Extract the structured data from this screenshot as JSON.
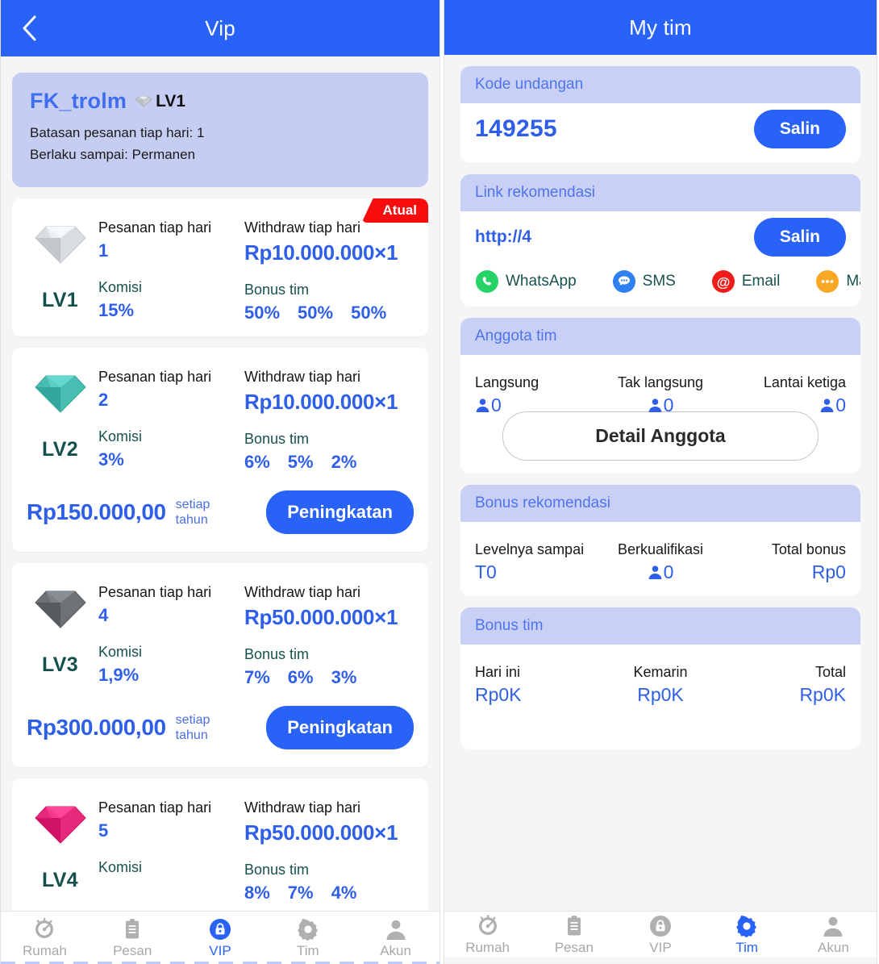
{
  "colors": {
    "accent": "#2962f6",
    "value_blue": "#2f5fe8",
    "card_head_bg": "#c8d0f5",
    "summary_bg": "#c5cdf2",
    "badge_red": "#f70d0d",
    "lv_label_teal": "#13504c",
    "page_bg": "#f5f5f6"
  },
  "left": {
    "header": {
      "title": "Vip",
      "back_icon": "chevron-left-icon"
    },
    "summary": {
      "username": "FK_trolm",
      "gem_icon": "diamond-icon",
      "level_badge": "LV1",
      "line1": "Batasan pesanan tiap hari: 1",
      "line2": "Berlaku sampai: Permanen"
    },
    "labels": {
      "orders_per_day": "Pesanan tiap hari",
      "commission": "Komisi",
      "withdraw_per_day": "Withdraw tiap hari",
      "team_bonus": "Bonus tim",
      "per_year": "setiap tahun",
      "upgrade": "Peningkatan",
      "current_badge": "Atual"
    },
    "levels": [
      {
        "name": "LV1",
        "gem_icon": "diamond-white-icon",
        "gem_color": "#d9dde1",
        "orders_per_day": "1",
        "commission": "15%",
        "withdraw_per_day": "Rp10.000.000×1",
        "team_bonus": [
          "50%",
          "50%",
          "50%"
        ],
        "is_current": true,
        "price": null,
        "show_upgrade": false
      },
      {
        "name": "LV2",
        "gem_icon": "diamond-teal-icon",
        "gem_color": "#49bdb2",
        "orders_per_day": "2",
        "commission": "3%",
        "withdraw_per_day": "Rp10.000.000×1",
        "team_bonus": [
          "6%",
          "5%",
          "2%"
        ],
        "is_current": false,
        "price": "Rp150.000,00",
        "show_upgrade": true
      },
      {
        "name": "LV3",
        "gem_icon": "diamond-dark-icon",
        "gem_color": "#6d7277",
        "orders_per_day": "4",
        "commission": "1,9%",
        "withdraw_per_day": "Rp50.000.000×1",
        "team_bonus": [
          "7%",
          "6%",
          "3%"
        ],
        "is_current": false,
        "price": "Rp300.000,00",
        "show_upgrade": true
      },
      {
        "name": "LV4",
        "gem_icon": "diamond-pink-icon",
        "gem_color": "#e6297a",
        "orders_per_day": "5",
        "commission": "",
        "withdraw_per_day": "Rp50.000.000×1",
        "team_bonus": [
          "8%",
          "7%",
          "4%"
        ],
        "is_current": false,
        "price": null,
        "show_upgrade": false
      }
    ],
    "tabs": [
      {
        "label": "Rumah",
        "icon": "speedometer-icon",
        "active": false
      },
      {
        "label": "Pesan",
        "icon": "clipboard-icon",
        "active": false
      },
      {
        "label": "VIP",
        "icon": "lock-bag-icon",
        "active": true
      },
      {
        "label": "Tim",
        "icon": "gear-icon",
        "active": false
      },
      {
        "label": "Akun",
        "icon": "person-icon",
        "active": false
      }
    ]
  },
  "right": {
    "header": {
      "title": "My tim"
    },
    "invite_code": {
      "heading": "Kode undangan",
      "value": "149255",
      "copy_label": "Salin"
    },
    "referral_link": {
      "heading": "Link rekomendasi",
      "value": "http://4",
      "copy_label": "Salin",
      "share": [
        {
          "label": "WhatsApp",
          "icon": "whatsapp-icon",
          "color": "#25d366"
        },
        {
          "label": "SMS",
          "icon": "sms-icon",
          "color": "#2f80f0"
        },
        {
          "label": "Email",
          "icon": "email-at-icon",
          "color": "#f01c1c"
        },
        {
          "label": "Mais",
          "icon": "more-dots-icon",
          "color": "#f9a825"
        }
      ]
    },
    "team_members": {
      "heading": "Anggota tim",
      "stats": [
        {
          "label": "Langsung",
          "value": "0",
          "icon": "person-icon"
        },
        {
          "label": "Tak langsung",
          "value": "0",
          "icon": "person-icon"
        },
        {
          "label": "Lantai ketiga",
          "value": "0",
          "icon": "person-icon"
        }
      ],
      "detail_button": "Detail Anggota"
    },
    "referral_bonus": {
      "heading": "Bonus rekomendasi",
      "stats": [
        {
          "label": "Levelnya sampai",
          "value": "T0",
          "icon": null
        },
        {
          "label": "Berkualifikasi",
          "value": "0",
          "icon": "person-icon"
        },
        {
          "label": "Total bonus",
          "value": "Rp0",
          "icon": null
        }
      ]
    },
    "team_bonus": {
      "heading": "Bonus tim",
      "stats": [
        {
          "label": "Hari ini",
          "value": "Rp0K",
          "icon": null
        },
        {
          "label": "Kemarin",
          "value": "Rp0K",
          "icon": null
        },
        {
          "label": "Total",
          "value": "Rp0K",
          "icon": null
        }
      ]
    },
    "tabs": [
      {
        "label": "Rumah",
        "icon": "speedometer-icon",
        "active": false
      },
      {
        "label": "Pesan",
        "icon": "clipboard-icon",
        "active": false
      },
      {
        "label": "VIP",
        "icon": "lock-bag-icon",
        "active": false
      },
      {
        "label": "Tim",
        "icon": "gear-icon",
        "active": true
      },
      {
        "label": "Akun",
        "icon": "person-icon",
        "active": false
      }
    ]
  }
}
